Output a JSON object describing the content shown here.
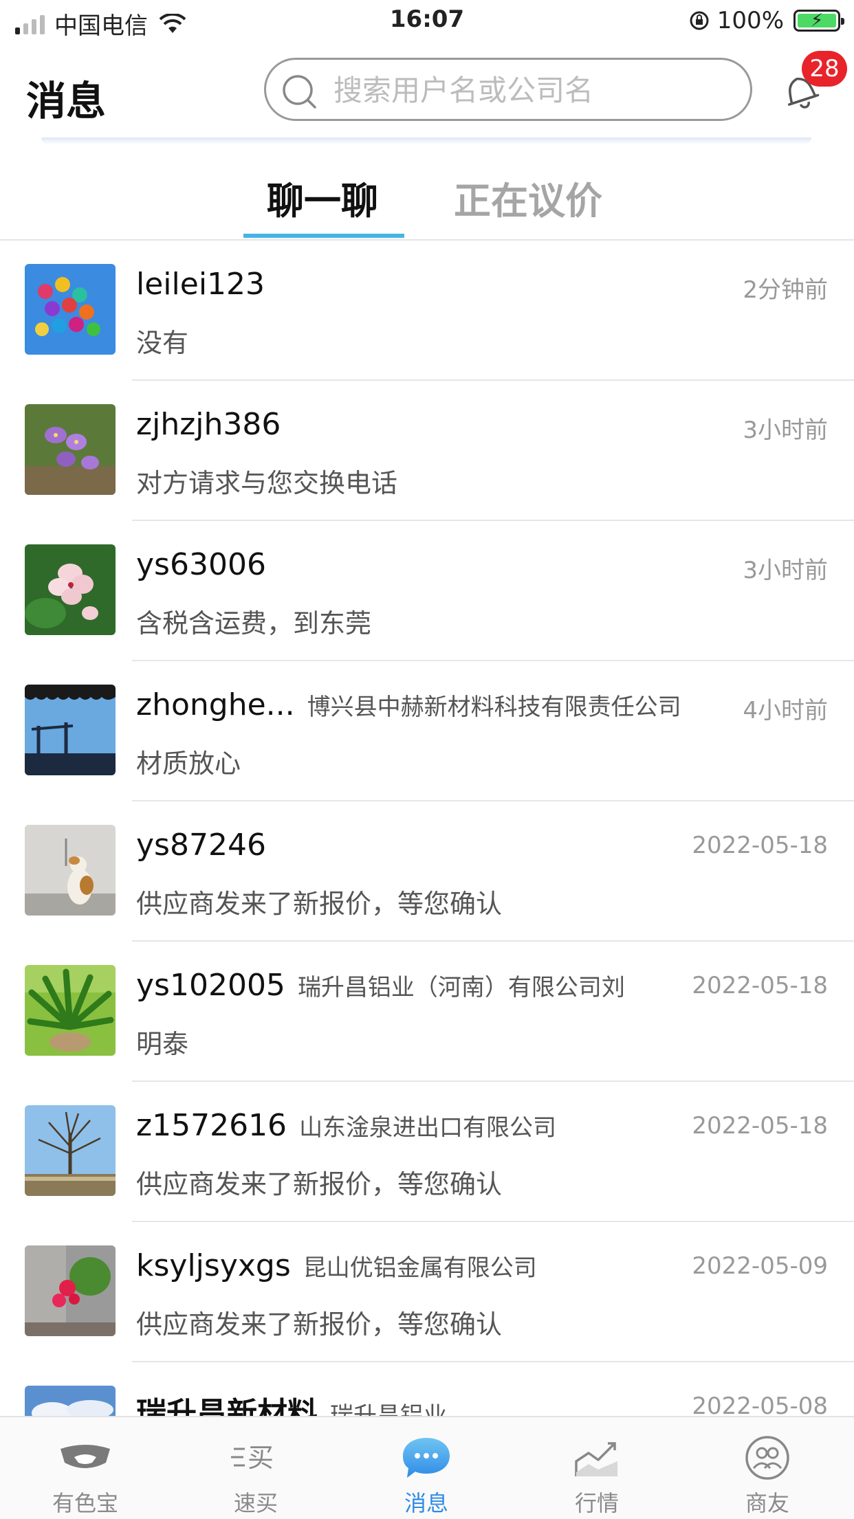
{
  "status_bar": {
    "carrier": "中国电信",
    "time": "16:07",
    "battery": "100%"
  },
  "header": {
    "title": "消息",
    "search_placeholder": "搜索用户名或公司名",
    "notification_count": "28"
  },
  "tabs": [
    {
      "label": "聊一聊",
      "active": true
    },
    {
      "label": "正在议价",
      "active": false
    }
  ],
  "chats": [
    {
      "name": "leilei123",
      "company": "",
      "time": "2分钟前",
      "message": "没有",
      "avatar": "balloons-photo"
    },
    {
      "name": "zjhzjh386",
      "company": "",
      "time": "3小时前",
      "message": "对方请求与您交换电话",
      "avatar": "purple-flowers-photo"
    },
    {
      "name": "ys63006",
      "company": "",
      "time": "3小时前",
      "message": "含税含运费，到东莞",
      "avatar": "pink-flowers-photo"
    },
    {
      "name": "zhonghe...",
      "company": "博兴县中赫新材料科技有限责任公司",
      "time": "4小时前",
      "message": "材质放心",
      "avatar": "blue-sky-photo"
    },
    {
      "name": "ys87246",
      "company": "",
      "time": "2022-05-18",
      "message": "供应商发来了新报价，等您确认",
      "avatar": "cat-photo"
    },
    {
      "name": "ys102005",
      "company": "瑞升昌铝业（河南）有限公司刘",
      "time": "2022-05-18",
      "message": "明泰",
      "avatar": "fern-plant-photo"
    },
    {
      "name": "z1572616",
      "company": "山东淦泉进出口有限公司",
      "time": "2022-05-18",
      "message": "供应商发来了新报价，等您确认",
      "avatar": "bare-tree-photo"
    },
    {
      "name": "ksyljsyxgs",
      "company": "昆山优铝金属有限公司",
      "time": "2022-05-09",
      "message": "供应商发来了新报价，等您确认",
      "avatar": "red-flower-photo"
    },
    {
      "name": "瑞升昌新材料",
      "company": "瑞升昌铝业—",
      "time": "2022-05-08",
      "message": "",
      "avatar": "cloudy-sky-photo"
    }
  ],
  "tab_bar": [
    {
      "label": "有色宝",
      "icon": "handshake-icon",
      "active": false
    },
    {
      "label": "速买",
      "icon": "quick-buy-icon",
      "active": false
    },
    {
      "label": "消息",
      "icon": "chat-bubble-icon",
      "active": true
    },
    {
      "label": "行情",
      "icon": "trend-chart-icon",
      "active": false
    },
    {
      "label": "商友",
      "icon": "friends-icon",
      "active": false
    }
  ],
  "colors": {
    "accent": "#45b3e3",
    "badge": "#e8232a",
    "active_tab_bar": "#2f8be6"
  }
}
